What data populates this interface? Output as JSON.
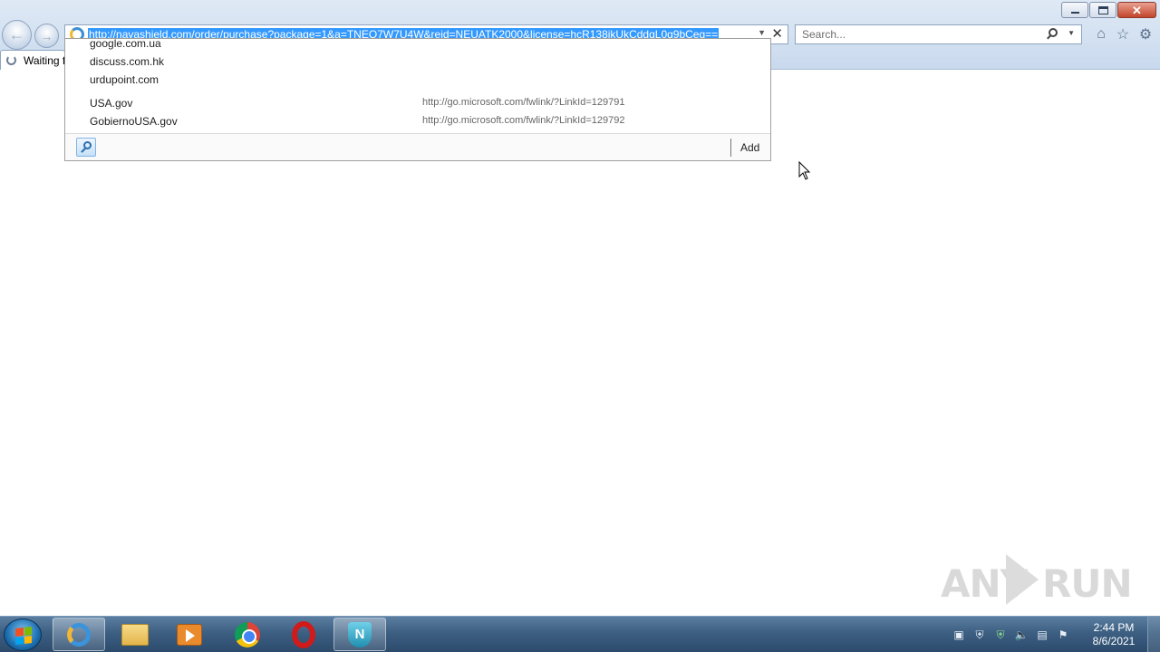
{
  "browser": {
    "address_url": "http://navashield.com/order/purchase?package=1&a=TNEQ7W7U4W&reid=NEUATK2000&license=hcR138jkUkCddqL0q9bCeg==",
    "search_placeholder": "Search...",
    "tab_title": "Waiting f"
  },
  "dropdown": {
    "history": [
      {
        "label": "google.com.ua"
      },
      {
        "label": "discuss.com.hk"
      },
      {
        "label": "urdupoint.com"
      }
    ],
    "favorites": [
      {
        "name": "USA.gov",
        "url": "http://go.microsoft.com/fwlink/?LinkId=129791"
      },
      {
        "name": "GobiernoUSA.gov",
        "url": "http://go.microsoft.com/fwlink/?LinkId=129792"
      }
    ],
    "add_label": "Add"
  },
  "taskbar": {
    "apps": [
      {
        "name": "internet-explorer"
      },
      {
        "name": "file-explorer"
      },
      {
        "name": "media-player"
      },
      {
        "name": "chrome"
      },
      {
        "name": "opera"
      },
      {
        "name": "navashield"
      }
    ],
    "clock_time": "2:44 PM",
    "clock_date": "8/6/2021"
  },
  "watermark": {
    "left": "ANY",
    "right": "RUN"
  },
  "colors": {
    "selection": "#3399ff",
    "taskbar": "#3d5f82"
  }
}
